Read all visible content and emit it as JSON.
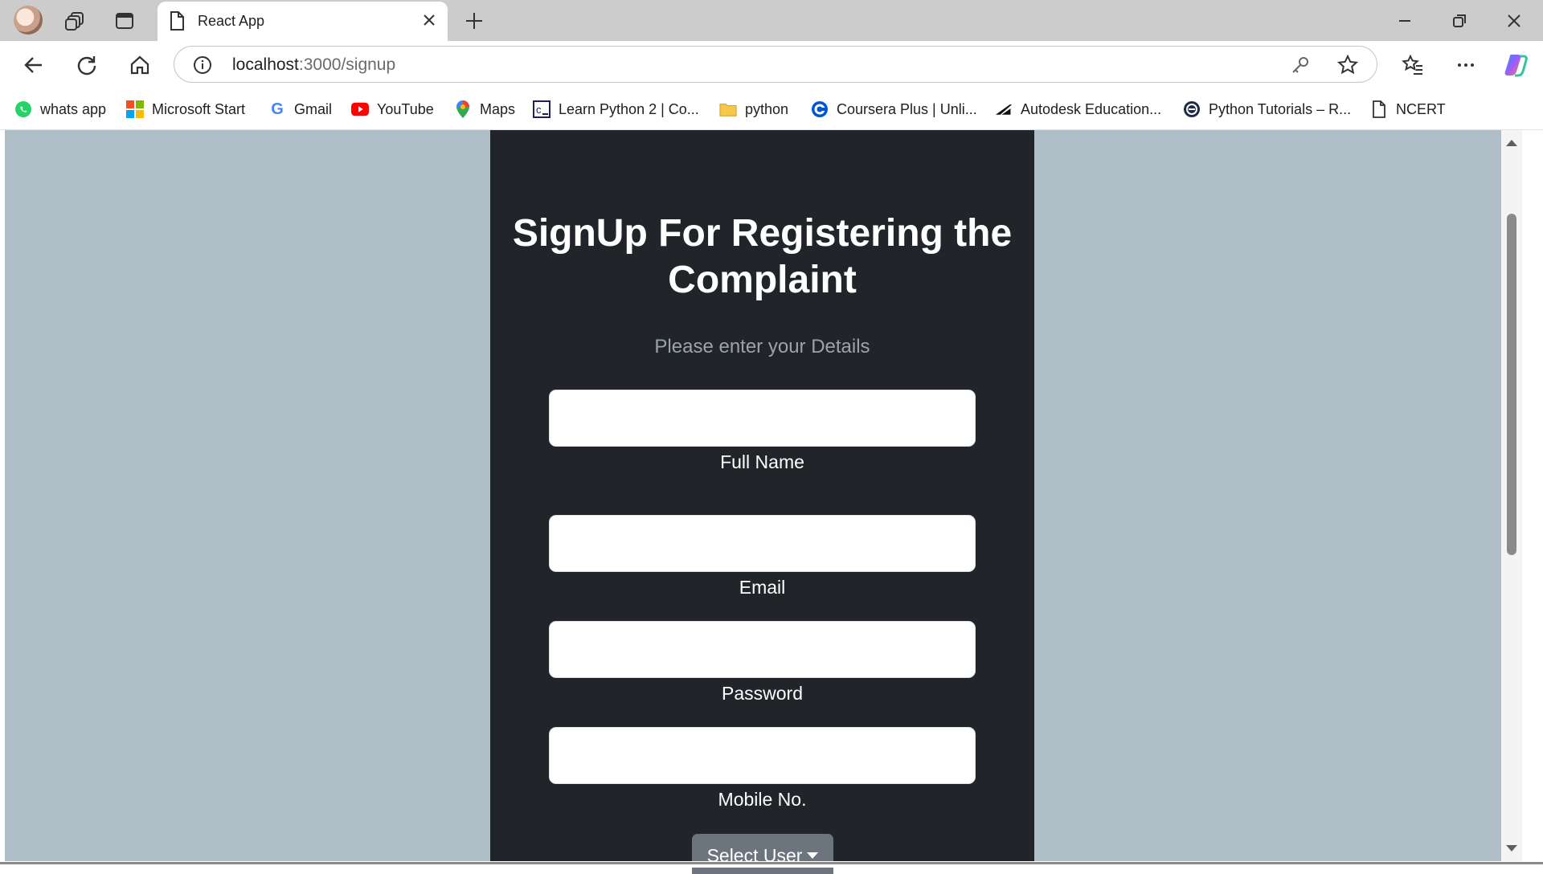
{
  "browser": {
    "tab_title": "React App",
    "url_host": "localhost",
    "url_path": ":3000/signup"
  },
  "bookmarks": [
    {
      "label": "whats app",
      "icon": "whatsapp-icon"
    },
    {
      "label": "Microsoft Start",
      "icon": "microsoft-icon"
    },
    {
      "label": "Gmail",
      "icon": "google-icon"
    },
    {
      "label": "YouTube",
      "icon": "youtube-icon"
    },
    {
      "label": "Maps",
      "icon": "maps-icon"
    },
    {
      "label": "Learn Python 2 | Co...",
      "icon": "codecademy-icon"
    },
    {
      "label": "python",
      "icon": "folder-icon"
    },
    {
      "label": "Coursera Plus | Unli...",
      "icon": "coursera-icon"
    },
    {
      "label": "Autodesk Education...",
      "icon": "autodesk-icon"
    },
    {
      "label": "Python Tutorials – R...",
      "icon": "realpython-icon"
    },
    {
      "label": "NCERT",
      "icon": "page-icon"
    }
  ],
  "form": {
    "title": "SignUp For Registering the Complaint",
    "subtitle": "Please enter your Details",
    "fields": [
      {
        "label": "Full Name",
        "value": ""
      },
      {
        "label": "Email",
        "value": ""
      },
      {
        "label": "Password",
        "value": ""
      },
      {
        "label": "Mobile No.",
        "value": ""
      }
    ],
    "select_user": "Select User"
  },
  "colors": {
    "page_bg": "#afbec6",
    "panel_bg": "#212529",
    "subtitle": "#9ba3aa",
    "select_button": "#6c757d"
  }
}
